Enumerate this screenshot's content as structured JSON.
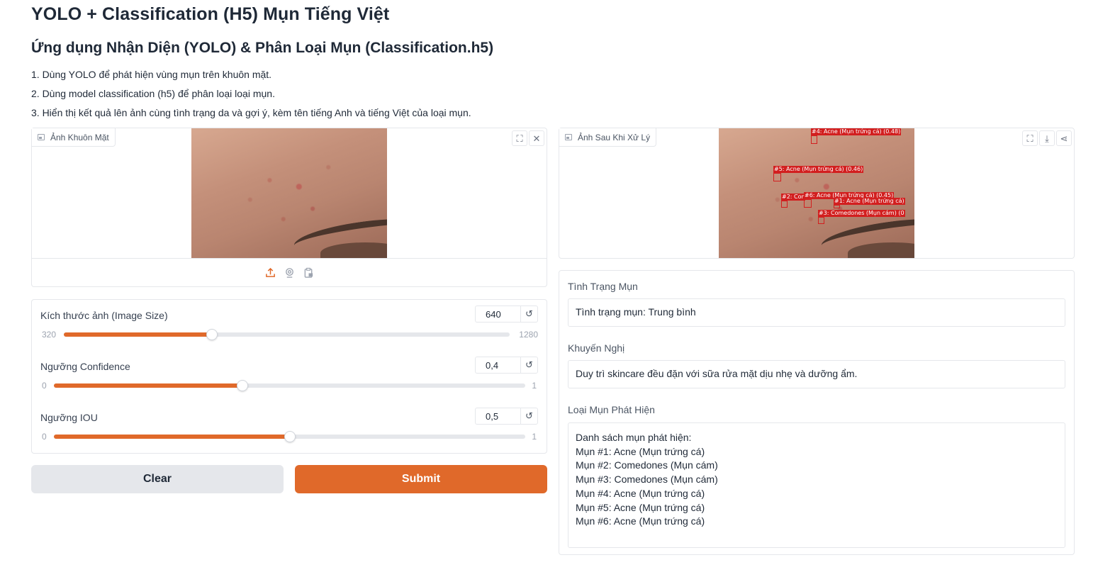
{
  "header": {
    "title": "YOLO + Classification (H5) Mụn Tiếng Việt",
    "subtitle": "Ứng dụng Nhận Diện (YOLO) & Phân Loại Mụn (Classification.h5)",
    "steps": [
      "1. Dùng YOLO để phát hiện vùng mụn trên khuôn mặt.",
      "2. Dùng model classification (h5) để phân loại loại mụn.",
      "3. Hiển thị kết quả lên ảnh cùng tình trạng da và gợi ý, kèm tên tiếng Anh và tiếng Việt của loại mụn."
    ]
  },
  "input_image": {
    "label": "Ảnh Khuôn Mặt",
    "icons": [
      "fullscreen-icon",
      "close-icon"
    ],
    "sources": [
      "upload-icon",
      "webcam-icon",
      "clipboard-icon"
    ]
  },
  "sliders": [
    {
      "label": "Kích thước ảnh (Image Size)",
      "value": "640",
      "min": "320",
      "max": "1280",
      "fraction": 0.333
    },
    {
      "label": "Ngưỡng Confidence",
      "value": "0,4",
      "min": "0",
      "max": "1",
      "fraction": 0.4
    },
    {
      "label": "Ngưỡng IOU",
      "value": "0,5",
      "min": "0",
      "max": "1",
      "fraction": 0.5
    }
  ],
  "buttons": {
    "clear": "Clear",
    "submit": "Submit"
  },
  "output_image": {
    "label": "Ảnh Sau Khi Xử Lý",
    "icons": [
      "fullscreen-icon",
      "download-icon",
      "share-icon"
    ],
    "detections": [
      "#4: Acne (Mụn trứng cá) (0.48)",
      "#5: Acne (Mụn trứng cá) (0.46)",
      "#2: Comedones",
      "#6: Acne (Mụn trứng cá) (0.45)",
      "#1: Acne (Mụn trứng cá)",
      "#3: Comedones (Mụn cám) (0"
    ]
  },
  "results": {
    "status_label": "Tình Trạng Mụn",
    "status_value": "Tình trạng mụn: Trung bình",
    "advice_label": "Khuyến Nghị",
    "advice_value": "Duy trì skincare đều đặn với sữa rửa mặt dịu nhẹ và dưỡng ẩm.",
    "types_label": "Loại Mụn Phát Hiện",
    "types_lines": [
      "Danh sách mụn phát hiện:",
      "Mụn #1: Acne (Mụn trứng cá)",
      "Mụn #2: Comedones (Mụn cám)",
      "Mụn #3: Comedones (Mụn cám)",
      "Mụn #4: Acne (Mụn trứng cá)",
      "Mụn #5: Acne (Mụn trứng cá)",
      "Mụn #6: Acne (Mụn trứng cá)"
    ]
  },
  "colors": {
    "accent": "#e0692a",
    "detection": "#d21f1f",
    "border": "#e5e7eb"
  }
}
